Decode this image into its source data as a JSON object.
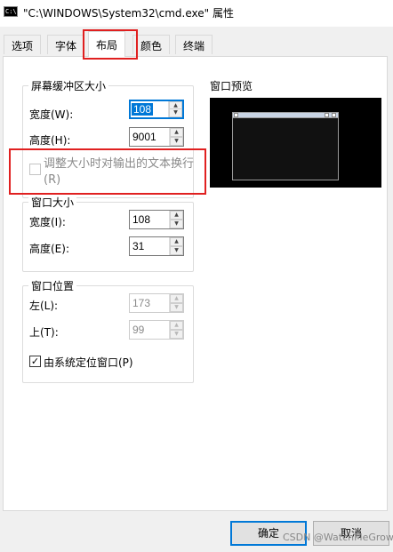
{
  "window": {
    "title": "\"C:\\WINDOWS\\System32\\cmd.exe\" 属性",
    "icon_name": "cmd-icon",
    "icon_glyph": "C:\\"
  },
  "tabs": [
    {
      "label": "选项",
      "active": false
    },
    {
      "label": "字体",
      "active": false
    },
    {
      "label": "布局",
      "active": true
    },
    {
      "label": "颜色",
      "active": false
    },
    {
      "label": "终端",
      "active": false
    }
  ],
  "buffer_group": {
    "label": "屏幕缓冲区大小",
    "width_label": "宽度(W):",
    "width_value": "108",
    "height_label": "高度(H):",
    "height_value": "9001",
    "wrap_label": "调整大小时对输出的文本换行(R)",
    "wrap_checked": false,
    "wrap_enabled": false
  },
  "window_size_group": {
    "label": "窗口大小",
    "width_label": "宽度(I):",
    "width_value": "108",
    "height_label": "高度(E):",
    "height_value": "31"
  },
  "position_group": {
    "label": "窗口位置",
    "left_label": "左(L):",
    "left_value": "173",
    "top_label": "上(T):",
    "top_value": "99",
    "system_position_label": "由系统定位窗口(P)",
    "system_position_checked": true
  },
  "preview": {
    "label": "窗口预览"
  },
  "buttons": {
    "ok": "确定",
    "cancel": "取消"
  },
  "watermark": "CSDN @WatchMeGrow",
  "colors": {
    "accent": "#0078d7",
    "annotation_red": "#e02020"
  }
}
